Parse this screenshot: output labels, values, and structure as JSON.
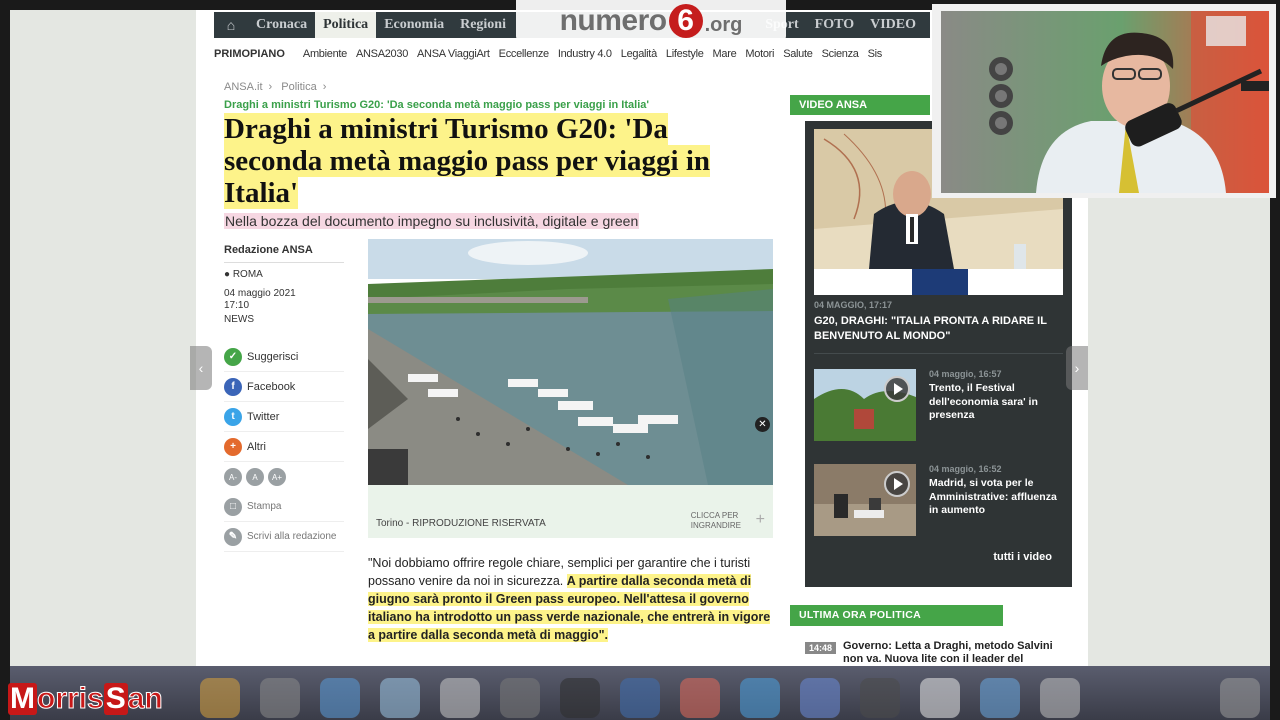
{
  "nav": {
    "items": [
      "Cronaca",
      "Politica",
      "Economia",
      "Regioni"
    ],
    "right_items": [
      "Sport",
      "FOTO",
      "VIDEO"
    ],
    "home_icon": "home-icon"
  },
  "logo": {
    "text1": "numero",
    "digit": "6",
    "text2": ".org"
  },
  "subnav": {
    "primo": "PRIMOPIANO",
    "items": [
      "Ambiente",
      "ANSA2030",
      "ANSA ViaggiArt",
      "Eccellenze",
      "Industry 4.0",
      "Legalità",
      "Lifestyle",
      "Mare",
      "Motori",
      "Salute",
      "Scienza",
      "Sis"
    ]
  },
  "breadcrumb": [
    "ANSA.it",
    "Politica"
  ],
  "article": {
    "kicker": "Draghi a ministri Turismo G20: 'Da seconda metà maggio pass per viaggi in Italia'",
    "title": "Draghi a ministri Turismo G20: 'Da seconda metà maggio pass per viaggi in Italia'",
    "subtitle": "Nella bozza del documento impegno su inclusività, digitale e green",
    "author": "Redazione ANSA",
    "location": "ROMA",
    "date": "04 maggio 2021",
    "time": "17:10",
    "tag": "NEWS",
    "photo_caption": "Torino - RIPRODUZIONE RISERVATA",
    "zoom_label_1": "CLICCA PER",
    "zoom_label_2": "INGRANDIRE",
    "body_plain": "\"Noi dobbiamo offrire regole chiare, semplici per garantire che i turisti possano venire da noi in sicurezza. ",
    "body_highlight": "A partire dalla seconda metà di giugno sarà pronto il Green pass europeo. Nell'attesa il governo italiano ha introdotto un pass verde nazionale, che entrerà in vigore a partire dalla seconda metà di maggio\"."
  },
  "share": {
    "suggest": "Suggerisci",
    "facebook": "Facebook",
    "twitter": "Twitter",
    "altri": "Altri",
    "font_minus": "A-",
    "font_reset": "A",
    "font_plus": "A+",
    "print": "Stampa",
    "write": "Scrivi alla redazione"
  },
  "video": {
    "header": "VIDEO ANSA",
    "main_date": "04 MAGGIO, 17:17",
    "main_title": "G20, DRAGHI: \"ITALIA PRONTA A RIDARE IL BENVENUTO AL MONDO\"",
    "items": [
      {
        "date": "04 maggio, 16:57",
        "title": "Trento, il Festival dell'economia sara' in presenza"
      },
      {
        "date": "04 maggio, 16:52",
        "title": "Madrid, si vota per le Amministrative: affluenza in aumento"
      }
    ],
    "all_videos": "tutti i video"
  },
  "latest": {
    "header": "ULTIMA ORA POLITICA",
    "time": "14:48",
    "title": "Governo: Letta a Draghi, metodo Salvini non va. Nuova lite con il leader del Carroccio"
  },
  "brand": {
    "letter": "M",
    "text1": "orris",
    "letter2": "S",
    "text2": "an"
  }
}
